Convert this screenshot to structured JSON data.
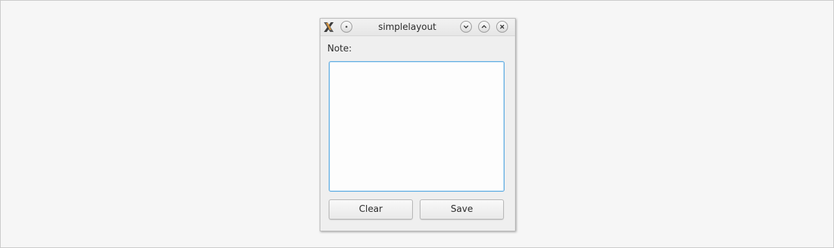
{
  "window": {
    "title": "simplelayout"
  },
  "titlebar": {
    "app_icon": "x-icon",
    "menu_button_icon": "dot-icon",
    "minimize_icon": "chevron-down-icon",
    "maximize_icon": "chevron-up-icon",
    "close_icon": "close-icon"
  },
  "form": {
    "note_label": "Note:",
    "note_value": "",
    "clear_label": "Clear",
    "save_label": "Save"
  },
  "colors": {
    "focus_border": "#5aa9e0",
    "background": "#f6f6f6"
  }
}
